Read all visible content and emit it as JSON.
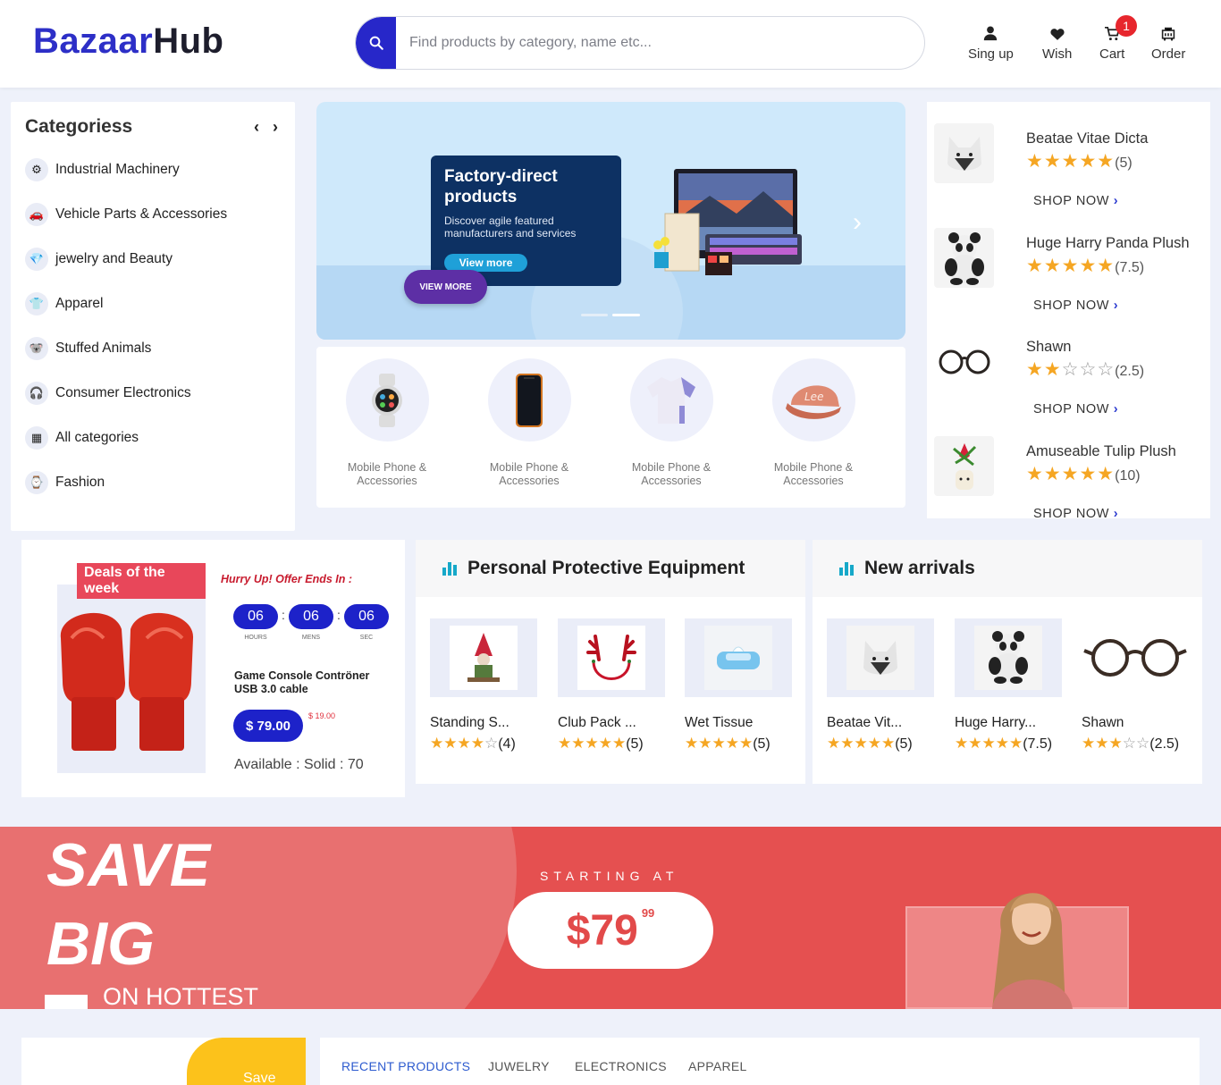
{
  "header": {
    "logo_part1": "Bazaar",
    "logo_part2": "Hub",
    "search_placeholder": "Find products by category, name etc...",
    "nav": [
      {
        "label": "Sing up",
        "icon": "user-icon"
      },
      {
        "label": "Wish",
        "icon": "heart-icon"
      },
      {
        "label": "Cart",
        "icon": "cart-icon"
      },
      {
        "label": "Order",
        "icon": "order-icon"
      }
    ],
    "cart_count": "1"
  },
  "categories": {
    "title": "Categoriess",
    "arrows": "‹ ›",
    "items": [
      {
        "label": "Industrial Machinery",
        "icon": "machinery-icon"
      },
      {
        "label": "Vehicle Parts & Accessories",
        "icon": "vehicle-icon"
      },
      {
        "label": "jewelry and Beauty",
        "icon": "jewelry-icon"
      },
      {
        "label": "Apparel",
        "icon": "apparel-icon"
      },
      {
        "label": "Stuffed Animals",
        "icon": "stuffed-animal-icon"
      },
      {
        "label": "Consumer Electronics",
        "icon": "electronics-icon"
      },
      {
        "label": "All categories",
        "icon": "grid-icon"
      },
      {
        "label": "Fashion",
        "icon": "fashion-icon"
      }
    ]
  },
  "hero": {
    "title": "Factory-direct products",
    "subtitle": "Discover agile featured manufacturers and services",
    "view_more_small": "View more",
    "view_more_btn": "VIEW MORE"
  },
  "tiles": [
    {
      "label": "Mobile Phone & Accessories",
      "icon": "smartwatch-icon"
    },
    {
      "label": "Mobile Phone & Accessories",
      "icon": "smartphone-icon"
    },
    {
      "label": "Mobile Phone & Accessories",
      "icon": "tshirt-icon"
    },
    {
      "label": "Mobile Phone & Accessories",
      "icon": "cap-icon"
    }
  ],
  "side_products": [
    {
      "name": "Beatae Vitae Dicta",
      "rating": 5,
      "count": "(5)",
      "shop": "SHOP NOW"
    },
    {
      "name": "Huge Harry Panda Plush",
      "rating": 5,
      "count": "(7.5)",
      "shop": "SHOP NOW"
    },
    {
      "name": "Shawn",
      "rating": 2,
      "count": "(2.5)",
      "shop": "SHOP NOW"
    },
    {
      "name": "Amuseable Tulip Plush",
      "rating": 5,
      "count": "(10)",
      "shop": "SHOP NOW"
    }
  ],
  "deal": {
    "tag": "Deals of the week",
    "hurry": "Hurry Up! Offer Ends In :",
    "countdown": [
      {
        "value": "06",
        "label": "HOURS"
      },
      {
        "value": "06",
        "label": "MENS"
      },
      {
        "value": "06",
        "label": "SEC"
      }
    ],
    "name": "Game Console Contröner USB 3.0 cable",
    "price": "$ 79.00",
    "old_price": "$ 19.00",
    "availability": "Available : Solid : 70"
  },
  "ppe": {
    "title": "Personal Protective Equipment",
    "products": [
      {
        "name": "Standing S...",
        "rating": 4,
        "count": "(4)"
      },
      {
        "name": "Club Pack ...",
        "rating": 5,
        "count": "(5)"
      },
      {
        "name": "Wet Tissue",
        "rating": 5,
        "count": "(5)"
      }
    ]
  },
  "arrivals": {
    "title": "New arrivals",
    "products": [
      {
        "name": "Beatae Vit...",
        "rating": 5,
        "count": "(5)"
      },
      {
        "name": "Huge Harry...",
        "rating": 5,
        "count": "(7.5)"
      },
      {
        "name": "Shawn",
        "rating": 3,
        "count": "(2.5)"
      }
    ]
  },
  "banner": {
    "line1": "SAVE",
    "line2": "BIG",
    "line3": "ON HOTTEST",
    "starting": "STARTING AT",
    "price": "$79",
    "cents": "99"
  },
  "bottom": {
    "save_label": "Save",
    "tabs": [
      "RECENT PRODUCTS",
      "JUWELRY",
      "ELECTRONICS",
      "APPAREL"
    ]
  },
  "colors": {
    "brand_blue": "#2d2fc7",
    "star": "#f5a623",
    "banner_red": "#e55050",
    "badge_red": "#e7262d"
  }
}
